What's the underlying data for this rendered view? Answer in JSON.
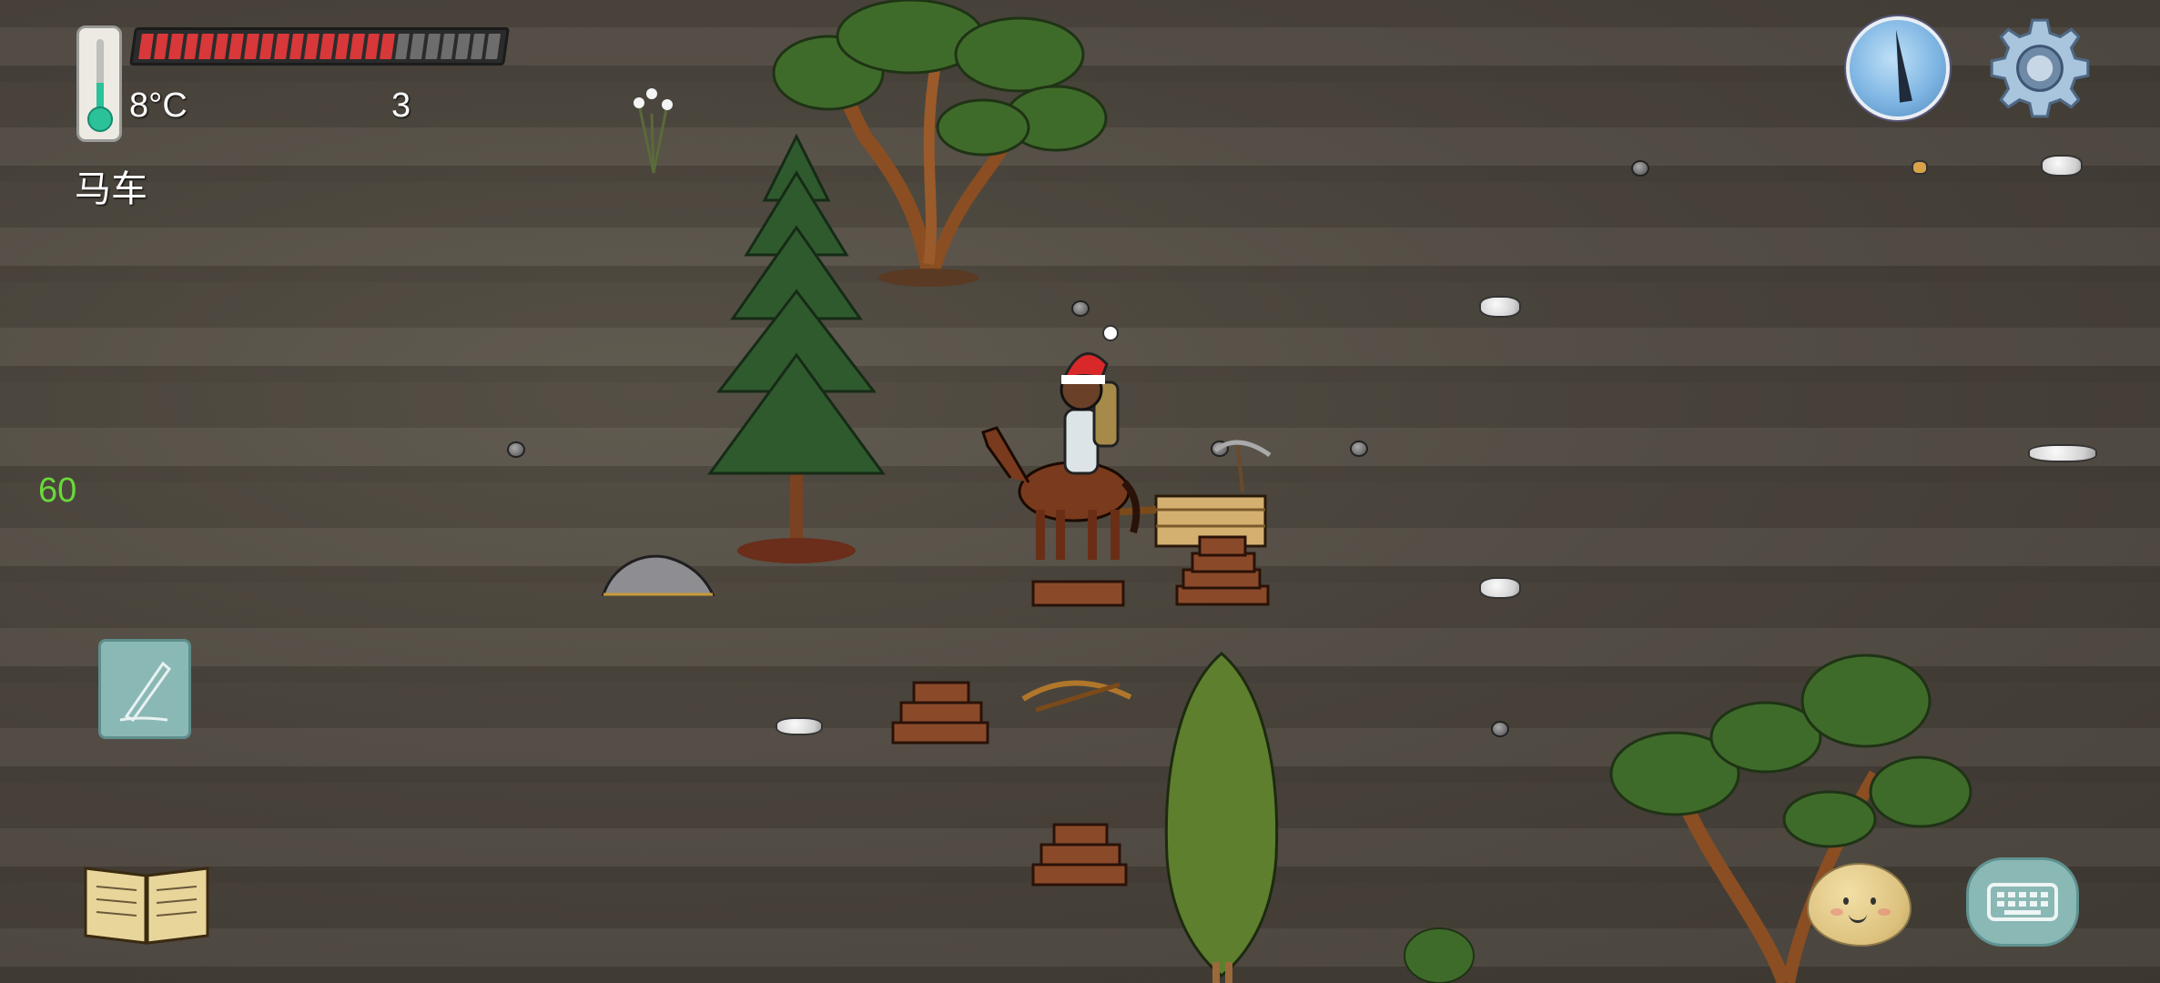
{
  "hud": {
    "temperature": "8°C",
    "count": "3",
    "location_label": "马车",
    "fps": "60",
    "health_bar": {
      "filled_segments": 17,
      "total_segments": 24,
      "color": "#d8383a"
    }
  },
  "icons": {
    "thermometer": "thermometer-icon",
    "compass": "compass-icon",
    "settings": "gear-icon",
    "journal": "pen-icon",
    "recipe_book": "book-icon",
    "emote": "potato-face-icon",
    "chat": "keyboard-icon"
  },
  "colors": {
    "ui_teal": "#8ab8b5",
    "fps_green": "#6ad83a",
    "ground": "#4c463e"
  }
}
